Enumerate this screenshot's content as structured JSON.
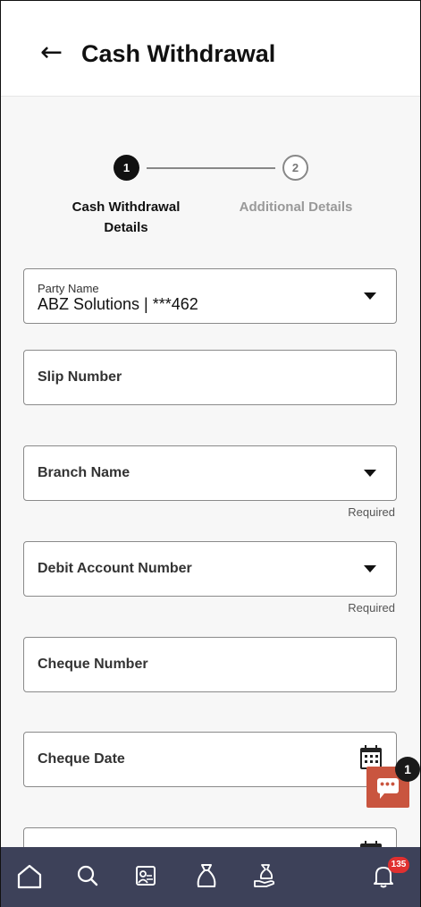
{
  "header": {
    "title": "Cash Withdrawal"
  },
  "stepper": {
    "steps": [
      {
        "number": "1",
        "label": "Cash Withdrawal Details",
        "active": true
      },
      {
        "number": "2",
        "label": "Additional Details",
        "active": false
      }
    ]
  },
  "form": {
    "party_name": {
      "label": "Party Name",
      "value": "ABZ Solutions | ***462"
    },
    "slip_number": {
      "label": "Slip Number"
    },
    "branch_name": {
      "label": "Branch Name",
      "hint": "Required"
    },
    "debit_account": {
      "label": "Debit Account Number",
      "hint": "Required"
    },
    "cheque_number": {
      "label": "Cheque Number"
    },
    "cheque_date": {
      "label": "Cheque Date"
    }
  },
  "chat": {
    "count": "1",
    "icon": "chat-icon",
    "color": "#c9553f"
  },
  "nav": {
    "items": [
      "home-icon",
      "search-icon",
      "accounts-icon",
      "bag-icon",
      "loan-icon",
      "bell-icon"
    ],
    "notification_count": "135",
    "background": "#3d4159"
  }
}
